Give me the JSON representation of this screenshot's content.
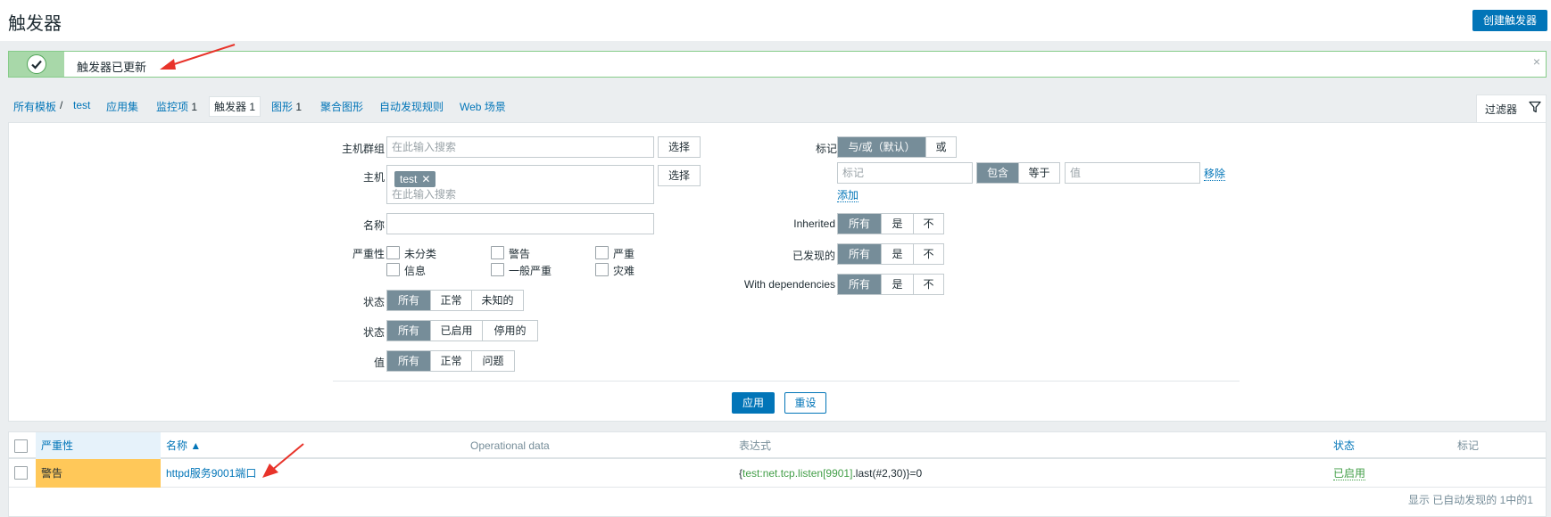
{
  "header": {
    "title": "触发器",
    "create_button": "创建触发器"
  },
  "message": {
    "text": "触发器已更新",
    "close": "×"
  },
  "breadcrumb": {
    "all_templates": "所有模板",
    "separator": "/",
    "host": "test",
    "applications": "应用集",
    "items": "监控项",
    "items_count": "1",
    "triggers": "触发器",
    "triggers_count": "1",
    "graphs": "图形",
    "graphs_count": "1",
    "aggregate_graphs": "聚合图形",
    "discovery_rules": "自动发现规则",
    "web_scenarios": "Web 场景"
  },
  "filter_tab": {
    "label": "过滤器",
    "icon": "filter-icon"
  },
  "filter": {
    "host_groups_label": "主机群组",
    "host_groups_placeholder": "在此输入搜索",
    "select_button": "选择",
    "hosts_label": "主机",
    "hosts_chip": "test",
    "hosts_chip_remove": "✕",
    "hosts_placeholder": "在此输入搜索",
    "name_label": "名称",
    "severity_label": "严重性",
    "severities": [
      "未分类",
      "警告",
      "严重",
      "信息",
      "一般严重",
      "灾难"
    ],
    "state_label": "状态",
    "state_options": [
      "所有",
      "正常",
      "未知的"
    ],
    "status_label": "状态",
    "status_options": [
      "所有",
      "已启用",
      "停用的"
    ],
    "value_label": "值",
    "value_options": [
      "所有",
      "正常",
      "问题"
    ],
    "tags_label": "标记",
    "tags_mode_options": [
      "与/或（默认）",
      "或"
    ],
    "tag_placeholder": "标记",
    "tag_operator_options": [
      "包含",
      "等于"
    ],
    "tag_value_placeholder": "值",
    "remove_link": "移除",
    "add_link": "添加",
    "inherited_label": "Inherited",
    "discovered_label": "已发现的",
    "with_dependencies_label": "With dependencies",
    "tri_options": [
      "所有",
      "是",
      "不"
    ],
    "apply_button": "应用",
    "reset_button": "重设"
  },
  "table": {
    "headers": {
      "severity": "严重性",
      "name": "名称 ▲",
      "operational_data": "Operational data",
      "expression": "表达式",
      "status": "状态",
      "tags": "标记"
    },
    "rows": [
      {
        "severity": "警告",
        "name": "httpd服务9001端口",
        "expression_open": "{",
        "expression_key": "test:net.tcp.listen[9901]",
        "expression_fn": ".last(#2,30)",
        "expression_close": "}=0",
        "status": "已启用"
      }
    ],
    "footer": "显示 已自动发现的 1中的1"
  },
  "colors": {
    "accent": "#0275b8",
    "success_border": "#86cc89",
    "warning_severity": "#ffc859",
    "enabled_green": "#429e47",
    "segment_selected": "#768d99",
    "annotation_arrow": "#e8332a"
  }
}
